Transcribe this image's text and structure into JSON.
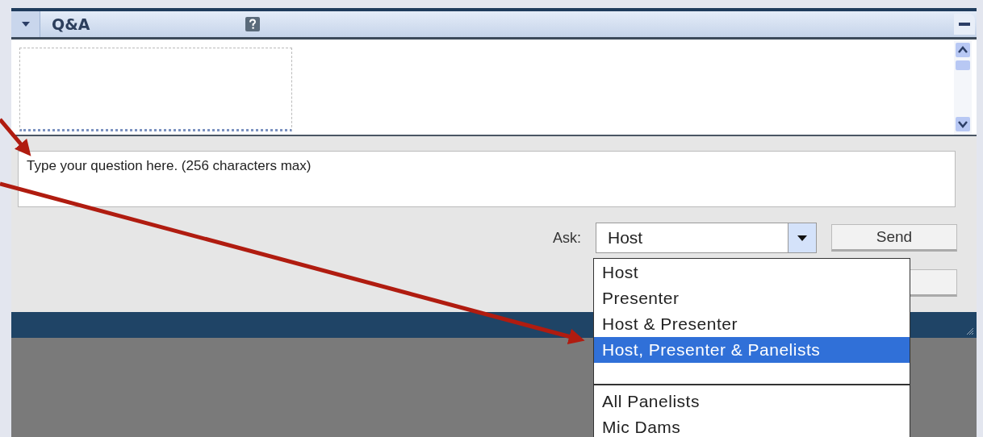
{
  "panel": {
    "title": "Q&A",
    "collapsed": false
  },
  "question": {
    "placeholder": "Type your question here. (256 characters max)"
  },
  "ask": {
    "label": "Ask:",
    "value": "Host"
  },
  "send_button": "Send",
  "dropdown": {
    "items": [
      {
        "kind": "option",
        "label": "Host",
        "selected": false
      },
      {
        "kind": "option",
        "label": "Presenter",
        "selected": false
      },
      {
        "kind": "option",
        "label": "Host & Presenter",
        "selected": false
      },
      {
        "kind": "option",
        "label": "Host, Presenter & Panelists",
        "selected": true
      },
      {
        "kind": "separator"
      },
      {
        "kind": "option",
        "label": "All Panelists",
        "selected": false
      },
      {
        "kind": "option",
        "label": "Mic Dams",
        "selected": false
      }
    ]
  }
}
